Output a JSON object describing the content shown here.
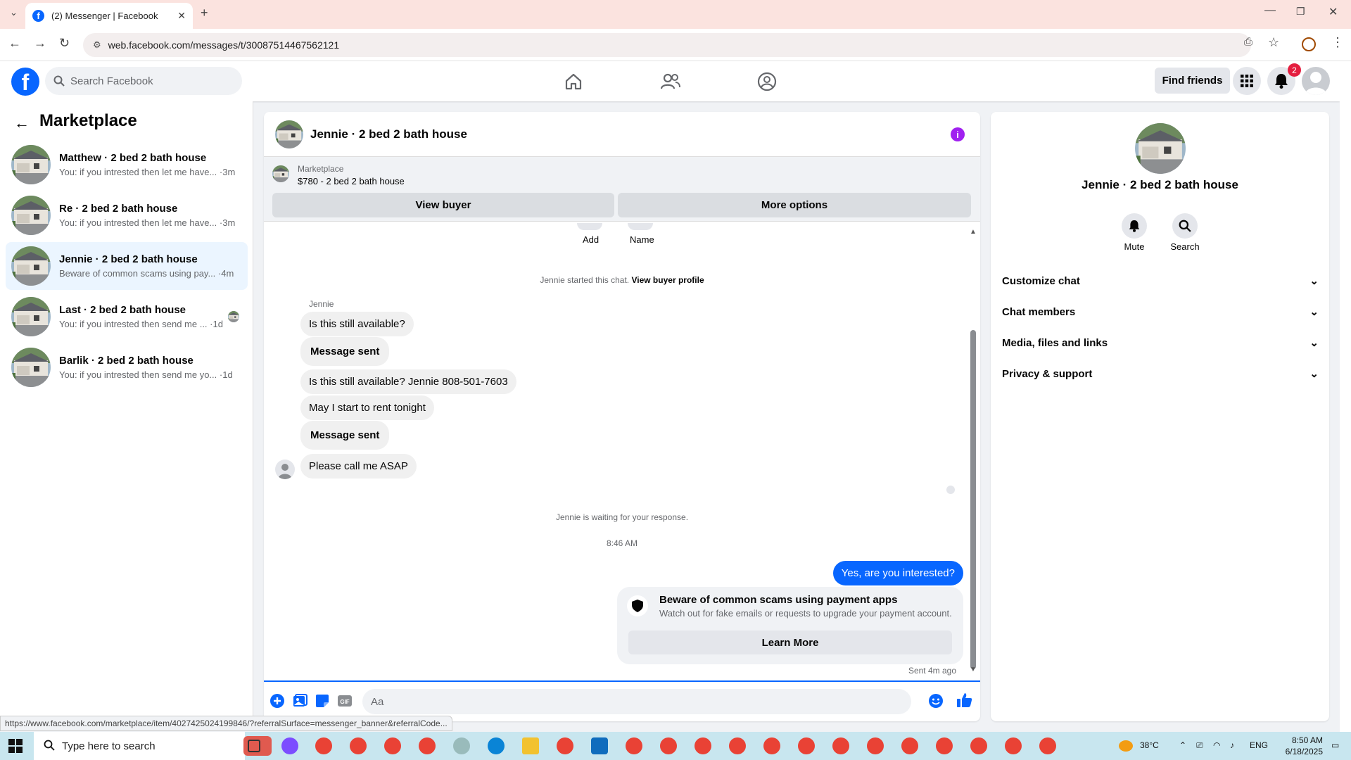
{
  "browser": {
    "tab_title": "(2) Messenger | Facebook",
    "url": "web.facebook.com/messages/t/30087514467562121",
    "status_url": "https://www.facebook.com/marketplace/item/4027425024199846/?referralSurface=messenger_banner&referralCode..."
  },
  "fb": {
    "search_placeholder": "Search Facebook",
    "find_friends": "Find friends",
    "notif_count": "2"
  },
  "sidebar": {
    "title": "Marketplace",
    "items": [
      {
        "name": "Matthew · 2 bed 2 bath house",
        "preview": "You: if you intrested then let me have... ·3m"
      },
      {
        "name": "Re · 2 bed 2 bath house",
        "preview": "You: if you intrested then let me have... ·3m"
      },
      {
        "name": "Jennie · 2 bed 2 bath house",
        "preview": "Beware of common scams using pay... ·4m"
      },
      {
        "name": "Last · 2 bed 2 bath house",
        "preview": "You: if you intrested then send me ... ·1d"
      },
      {
        "name": "Barlik · 2 bed 2 bath house",
        "preview": "You: if you intrested then send me yo... ·1d"
      }
    ]
  },
  "chat": {
    "title": "Jennie · 2 bed 2 bath house",
    "listing_label": "Marketplace",
    "listing_price": "$780 - 2 bed 2 bath house",
    "view_buyer": "View buyer",
    "more_options": "More options",
    "add_label": "Add",
    "name_label": "Name",
    "started_text": "Jennie started this chat.",
    "view_profile": "View buyer profile",
    "sender": "Jennie",
    "messages": [
      {
        "text": "Is this still available?",
        "bold": false
      },
      {
        "text": "Message sent",
        "bold": true
      },
      {
        "text": "Is this still available? Jennie 808-501-7603",
        "bold": false
      },
      {
        "text": "May I start to rent tonight",
        "bold": false
      },
      {
        "text": "Message sent",
        "bold": true
      },
      {
        "text": "Please call me ASAP",
        "bold": false
      }
    ],
    "waiting": "Jennie is waiting for your response.",
    "time": "8:46 AM",
    "my_message": "Yes, are you interested?",
    "scam_title": "Beware of common scams using payment apps",
    "scam_body": "Watch out for fake emails or requests to upgrade your payment account.",
    "learn_more": "Learn More",
    "sent": "Sent 4m ago",
    "composer_placeholder": "Aa"
  },
  "panel": {
    "name": "Jennie · 2 bed 2 bath house",
    "mute": "Mute",
    "search": "Search",
    "sections": [
      "Customize chat",
      "Chat members",
      "Media, files and links",
      "Privacy & support"
    ]
  },
  "taskbar": {
    "search_placeholder": "Type here to search",
    "temp": "38°C",
    "lang": "ENG",
    "time": "8:50 AM",
    "date": "6/18/2025"
  },
  "colors": {
    "brand": "#0866ff",
    "info": "#a020f0",
    "badge": "#e41e3f"
  }
}
